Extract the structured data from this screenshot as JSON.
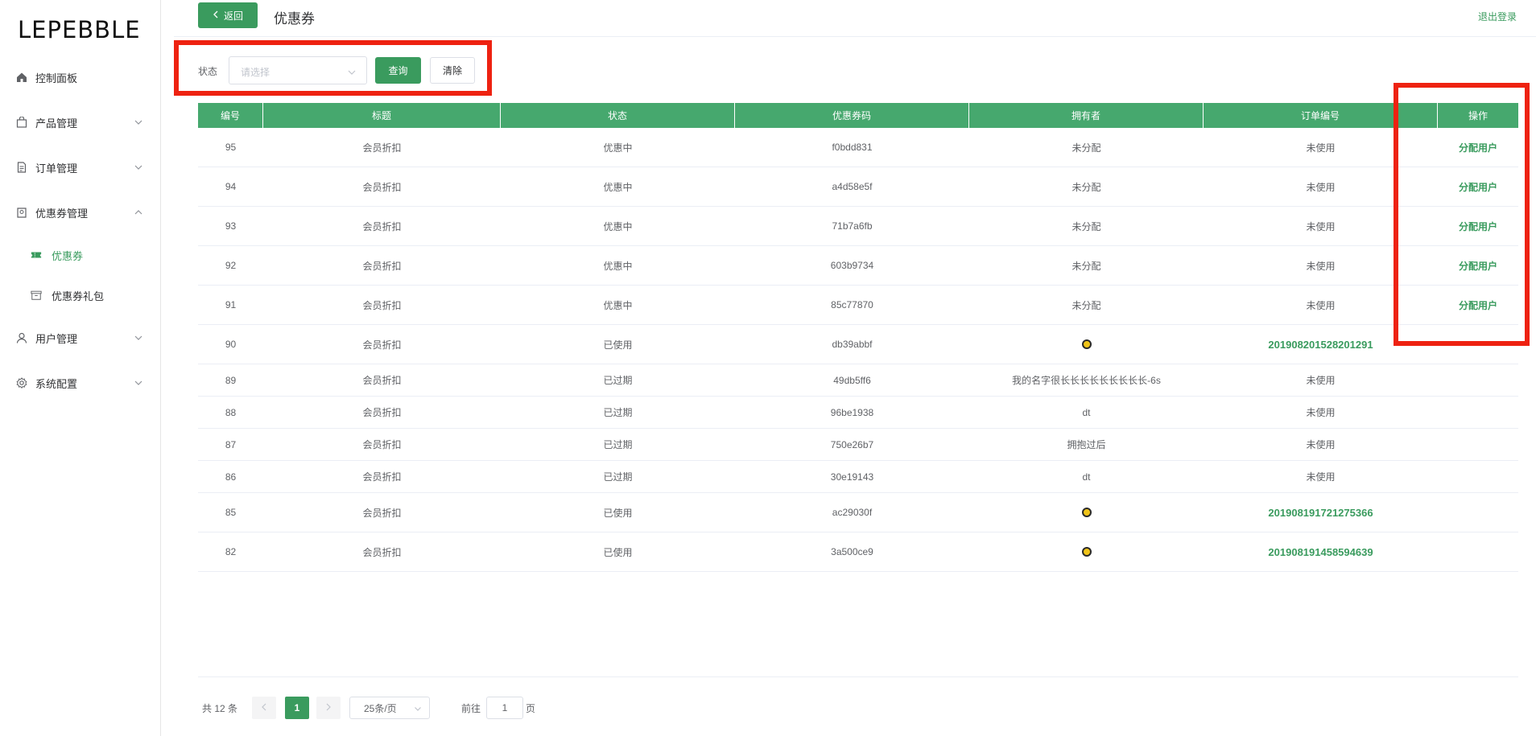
{
  "sidebar": {
    "logo": "LEPEBBLE",
    "items": [
      {
        "label": "控制面板"
      },
      {
        "label": "产品管理"
      },
      {
        "label": "订单管理"
      },
      {
        "label": "优惠券管理"
      },
      {
        "label": "优惠券"
      },
      {
        "label": "优惠券礼包"
      },
      {
        "label": "用户管理"
      },
      {
        "label": "系统配置"
      }
    ]
  },
  "header": {
    "back_label": "返回",
    "title": "优惠券",
    "logout_label": "退出登录"
  },
  "filter": {
    "status_label": "状态",
    "status_placeholder": "请选择",
    "query_label": "查询",
    "clear_label": "清除"
  },
  "table": {
    "columns": [
      "编号",
      "标题",
      "状态",
      "优惠券码",
      "拥有者",
      "订单编号",
      "操作"
    ],
    "rows": [
      {
        "id": "95",
        "title": "会员折扣",
        "status": "优惠中",
        "code": "f0bdd831",
        "owner": "未分配",
        "order": "未使用",
        "action": "分配用户"
      },
      {
        "id": "94",
        "title": "会员折扣",
        "status": "优惠中",
        "code": "a4d58e5f",
        "owner": "未分配",
        "order": "未使用",
        "action": "分配用户"
      },
      {
        "id": "93",
        "title": "会员折扣",
        "status": "优惠中",
        "code": "71b7a6fb",
        "owner": "未分配",
        "order": "未使用",
        "action": "分配用户"
      },
      {
        "id": "92",
        "title": "会员折扣",
        "status": "优惠中",
        "code": "603b9734",
        "owner": "未分配",
        "order": "未使用",
        "action": "分配用户"
      },
      {
        "id": "91",
        "title": "会员折扣",
        "status": "优惠中",
        "code": "85c77870",
        "owner": "未分配",
        "order": "未使用",
        "action": "分配用户"
      },
      {
        "id": "90",
        "title": "会员折扣",
        "status": "已使用",
        "code": "db39abbf",
        "owner": "",
        "order": "201908201528201291",
        "action": ""
      },
      {
        "id": "89",
        "title": "会员折扣",
        "status": "已过期",
        "code": "49db5ff6",
        "owner": "我的名字很长长长长长长长长长-6s",
        "order": "未使用",
        "action": ""
      },
      {
        "id": "88",
        "title": "会员折扣",
        "status": "已过期",
        "code": "96be1938",
        "owner": "dt",
        "order": "未使用",
        "action": ""
      },
      {
        "id": "87",
        "title": "会员折扣",
        "status": "已过期",
        "code": "750e26b7",
        "owner": "拥抱过后",
        "order": "未使用",
        "action": ""
      },
      {
        "id": "86",
        "title": "会员折扣",
        "status": "已过期",
        "code": "30e19143",
        "owner": "dt",
        "order": "未使用",
        "action": ""
      },
      {
        "id": "85",
        "title": "会员折扣",
        "status": "已使用",
        "code": "ac29030f",
        "owner": "",
        "order": "201908191721275366",
        "action": ""
      },
      {
        "id": "82",
        "title": "会员折扣",
        "status": "已使用",
        "code": "3a500ce9",
        "owner": "",
        "order": "201908191458594639",
        "action": ""
      }
    ]
  },
  "pagination": {
    "total_label": "共 12 条",
    "current_page": "1",
    "page_size_label": "25条/页",
    "goto_label": "前往",
    "goto_value": "1",
    "page_suffix": "页"
  },
  "colors": {
    "accent": "#3a9b5e",
    "header_bg": "#46a86e",
    "highlight": "#ee2211"
  }
}
